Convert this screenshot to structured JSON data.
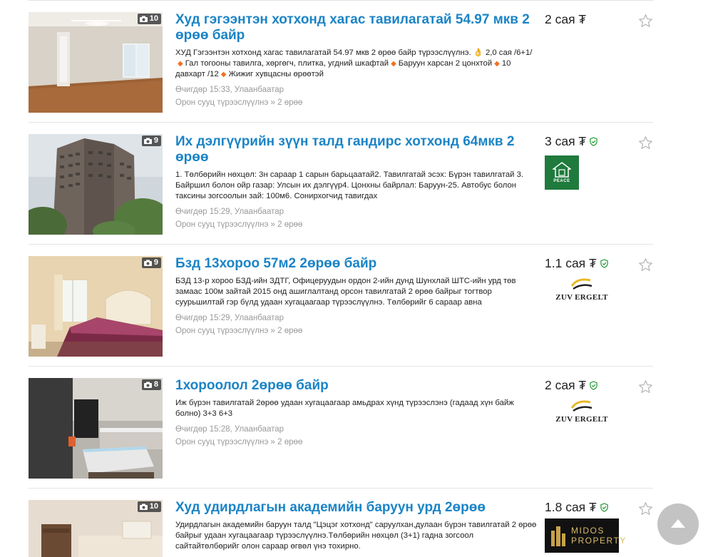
{
  "listings": [
    {
      "title": "Худ гэгээнтэн хотхонд хагас тавилагатай 54.97 мкв 2 өрөө байр",
      "photo_count": "10",
      "desc_parts": [
        "ХУД Гэгээнтэн хотхонд хагас тавилагатай 54.97 мкв 2 өрөө байр түрээслүүлнэ. 👌 2,0 сая /6+1/",
        "Гал тогооны тавилга, хөргөгч, плитка, угдний шкафтай",
        "Баруун харсан 2 цонхтой",
        "10 давхарт /12",
        "Жижиг хувцасны өрөөтэй"
      ],
      "date_location": "Өчигдөр 15:33, Улаанбаатар",
      "category": "Орон сууц түрээслүүлнэ » 2 өрөө",
      "price": "2 сая ₮",
      "verified": false
    },
    {
      "title": "Их дэлгүүрийн зүүн талд гандирс хотхонд 64мкв 2 өрөө",
      "photo_count": "9",
      "description": "1. Төлбөрийн нөхцөл: 3н сараар 1 сарын барьцаатай2. Тавилгатай эсэх: Бүрэн тавилгатай 3. Байршил болон ойр газар: Улсын их дэлгүүр4. Цонхны байрлал: Баруун-25. Автобус болон таксины зогсоолын зай: 100м6. Сонирхогчид тавигдах",
      "date_location": "Өчигдөр 15:29, Улаанбаатар",
      "category": "Орон сууц түрээслүүлнэ » 2 өрөө",
      "price": "3 сая ₮",
      "verified": true,
      "logo_text": "PEACE"
    },
    {
      "title": "Бзд 13хороо 57м2 2өрөө байр",
      "photo_count": "9",
      "description": "БЗД 13-р хороо БЗД-ийн ЗДТГ, Офицеруудын ордон 2-ийн дунд Шунхлай ШТС-ийн урд төв замаас 100м зайтай 2015 онд ашиглалтанд орсон тавилгатай 2 өрөө байрыг тогтвор суурьшилтай гэр бүлд удаан хугацаагаар түрээслүүлнэ. Төлбөрийг 6 сараар авна",
      "date_location": "Өчигдөр 15:29, Улаанбаатар",
      "category": "Орон сууц түрээслүүлнэ » 2 өрөө",
      "price": "1.1 сая ₮",
      "verified": true,
      "logo_text": "ZUV ERGELT"
    },
    {
      "title": "1хороолол 2өрөө байр",
      "photo_count": "8",
      "description": "Иж бүрэн тавилгатай 2өрөө удаан хугацаагаар амьдрах хүнд түрээслэнэ (гадаад хүн байж болно) 3+3 6+3",
      "date_location": "Өчигдөр 15:28, Улаанбаатар",
      "category": "Орон сууц түрээслүүлнэ » 2 өрөө",
      "price": "2 сая ₮",
      "verified": true,
      "logo_text": "ZUV ERGELT"
    },
    {
      "title": "Худ удирдлагын академийн баруун урд 2өрөө",
      "photo_count": "10",
      "description": "Удирдлагын академийн баруун талд \"Цэцэг хотхонд\" саруулхан,дулаан бүрэн тавилгатай 2 өрөө байрыг удаан хугацаагаар түрээслүүлнэ.Төлбөрийн нөхцөл (3+1) гадна зогсоол сайтайтөлбөрийг олон сараар өгвөл үнэ тохирно.",
      "price": "1.8 сая ₮",
      "verified": true,
      "logo_text": "MIDOS PROPERTY"
    }
  ],
  "colors": {
    "title": "#1b84c6",
    "bullet": "#f07020",
    "verified": "#2e9e3e",
    "meta": "#9a9a9a"
  },
  "icons": {
    "photo_count": "camera-icon",
    "favorite": "star-outline-icon",
    "verified": "shield-check-icon",
    "scroll_top": "arrow-up-icon"
  }
}
